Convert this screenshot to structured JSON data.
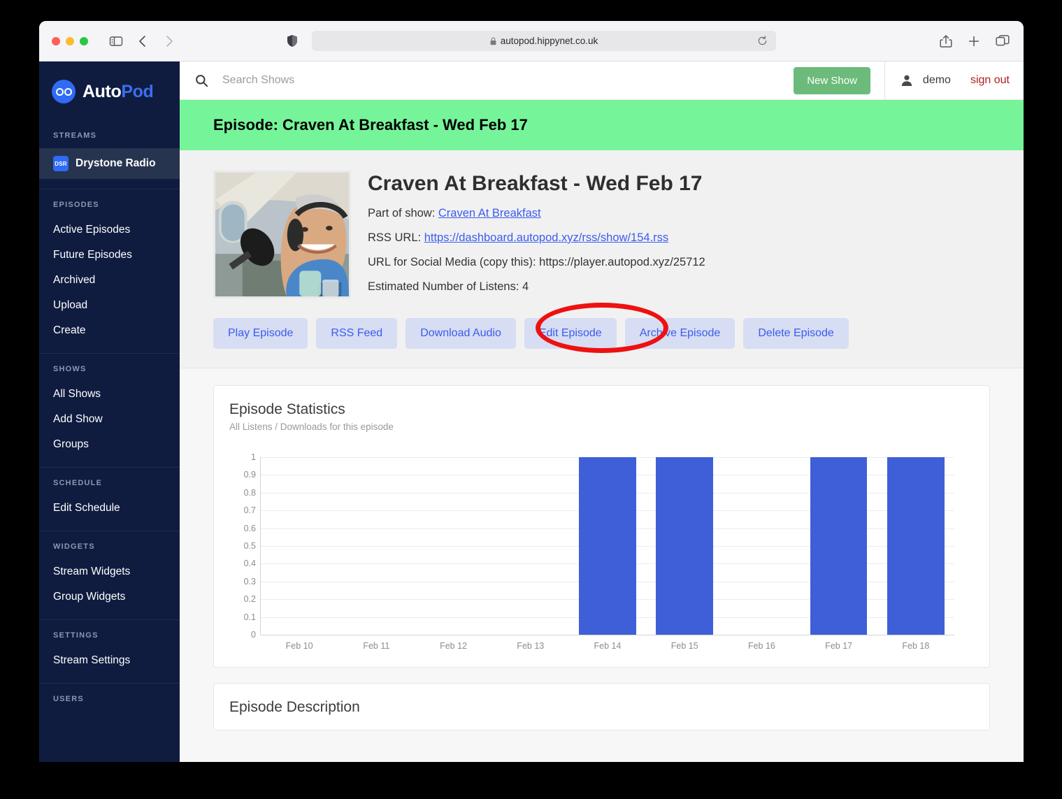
{
  "browser": {
    "url": "autopod.hippynet.co.uk",
    "lock_icon": "lock-icon",
    "reload_icon": "reload-icon",
    "share_icon": "share-icon",
    "new_tab_icon": "plus-icon",
    "tabs_icon": "tab-overview-icon"
  },
  "sidebar": {
    "brand": {
      "auto": "Auto",
      "pod": "Pod"
    },
    "sections": [
      {
        "heading": "STREAMS",
        "items": [
          {
            "label": "Drystone Radio",
            "badge": "DSR",
            "active": true
          }
        ]
      },
      {
        "heading": "EPISODES",
        "items": [
          {
            "label": "Active Episodes"
          },
          {
            "label": "Future Episodes"
          },
          {
            "label": "Archived"
          },
          {
            "label": "Upload"
          },
          {
            "label": "Create"
          }
        ]
      },
      {
        "heading": "SHOWS",
        "items": [
          {
            "label": "All Shows"
          },
          {
            "label": "Add Show"
          },
          {
            "label": "Groups"
          }
        ]
      },
      {
        "heading": "SCHEDULE",
        "items": [
          {
            "label": "Edit Schedule"
          }
        ]
      },
      {
        "heading": "WIDGETS",
        "items": [
          {
            "label": "Stream Widgets"
          },
          {
            "label": "Group Widgets"
          }
        ]
      },
      {
        "heading": "SETTINGS",
        "items": [
          {
            "label": "Stream Settings"
          }
        ]
      },
      {
        "heading": "USERS",
        "items": []
      }
    ]
  },
  "topbar": {
    "search_placeholder": "Search Shows",
    "search_value": "",
    "search_icon": "search-icon",
    "new_show_label": "New Show",
    "user_icon": "user-icon",
    "username": "demo",
    "sign_out_label": "sign out"
  },
  "banner": {
    "title": "Episode: Craven At Breakfast - Wed Feb 17",
    "color": "#76f49a"
  },
  "episode": {
    "title": "Craven At Breakfast - Wed Feb 17",
    "part_of_show_label": "Part of show:",
    "show_name": "Craven At Breakfast",
    "rss_label": "RSS URL:",
    "rss_url": "https://dashboard.autopod.xyz/rss/show/154.rss",
    "social_label": "URL for Social Media (copy this):",
    "social_url": "https://player.autopod.xyz/25712",
    "listens_label": "Estimated Number of Listens: 4",
    "buttons": [
      "Play Episode",
      "RSS Feed",
      "Download Audio",
      "Edit Episode",
      "Archive Episode",
      "Delete Episode"
    ],
    "annotation": {
      "target": "Archive Episode",
      "color": "#ee1111"
    }
  },
  "statistics": {
    "title": "Episode Statistics",
    "subtitle": "All Listens / Downloads for this episode"
  },
  "description": {
    "title": "Episode Description"
  },
  "chart_data": {
    "type": "bar",
    "title": "Episode Statistics",
    "subtitle": "All Listens / Downloads for this episode",
    "categories": [
      "Feb 10",
      "Feb 11",
      "Feb 12",
      "Feb 13",
      "Feb 14",
      "Feb 15",
      "Feb 16",
      "Feb 17",
      "Feb 18"
    ],
    "values": [
      0,
      0,
      0,
      0,
      1,
      1,
      0,
      1,
      1
    ],
    "yticks": [
      "1",
      "0.9",
      "0.8",
      "0.7",
      "0.6",
      "0.5",
      "0.4",
      "0.3",
      "0.2",
      "0.1",
      "0"
    ],
    "ylim": [
      0,
      1
    ],
    "xlabel": "",
    "ylabel": "",
    "grid": true,
    "legend": false,
    "bar_color": "#3f5fd9"
  }
}
